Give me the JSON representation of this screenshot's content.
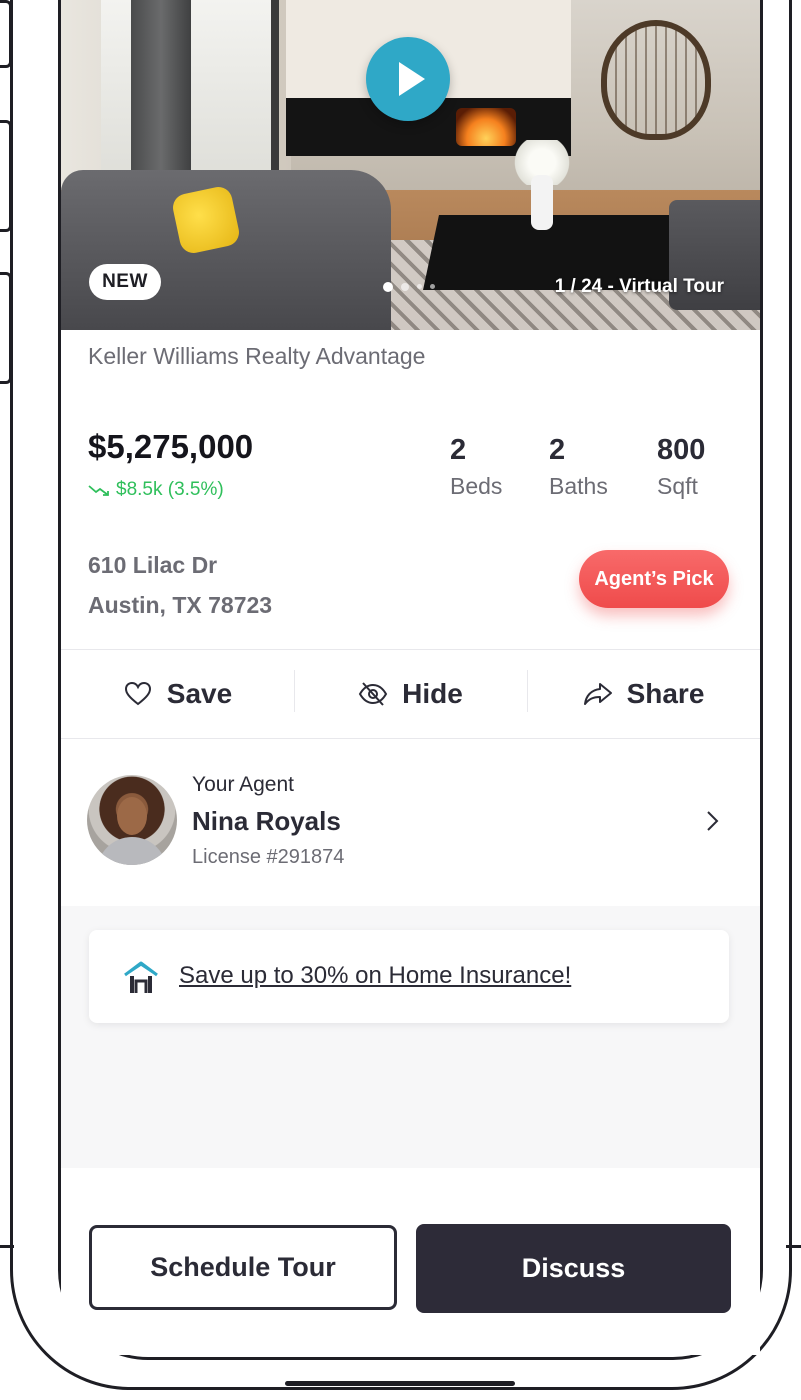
{
  "hero": {
    "badge": "NEW",
    "photo_counter": "1 / 24 - Virtual Tour"
  },
  "listing": {
    "brokerage": "Keller Williams Realty Advantage",
    "price": "$5,275,000",
    "price_change": "$8.5k (3.5%)",
    "beds": {
      "value": "2",
      "label": "Beds"
    },
    "baths": {
      "value": "2",
      "label": "Baths"
    },
    "sqft": {
      "value": "800",
      "label": "Sqft"
    },
    "address_line1": "610 Lilac Dr",
    "address_line2": "Austin, TX 78723",
    "tag": "Agent’s Pick"
  },
  "actions": {
    "save": "Save",
    "hide": "Hide",
    "share": "Share"
  },
  "agent": {
    "label": "Your Agent",
    "name": "Nina Royals",
    "license": "License #291874"
  },
  "promo": {
    "text": "Save up to 30% on Home Insurance!"
  },
  "footer": {
    "schedule": "Schedule Tour",
    "discuss": "Discuss"
  },
  "colors": {
    "accent_teal": "#2fa8c7",
    "price_down_green": "#2fbf5b",
    "agents_pick_red": "#ef4b4b",
    "dark_button": "#2d2b38"
  }
}
